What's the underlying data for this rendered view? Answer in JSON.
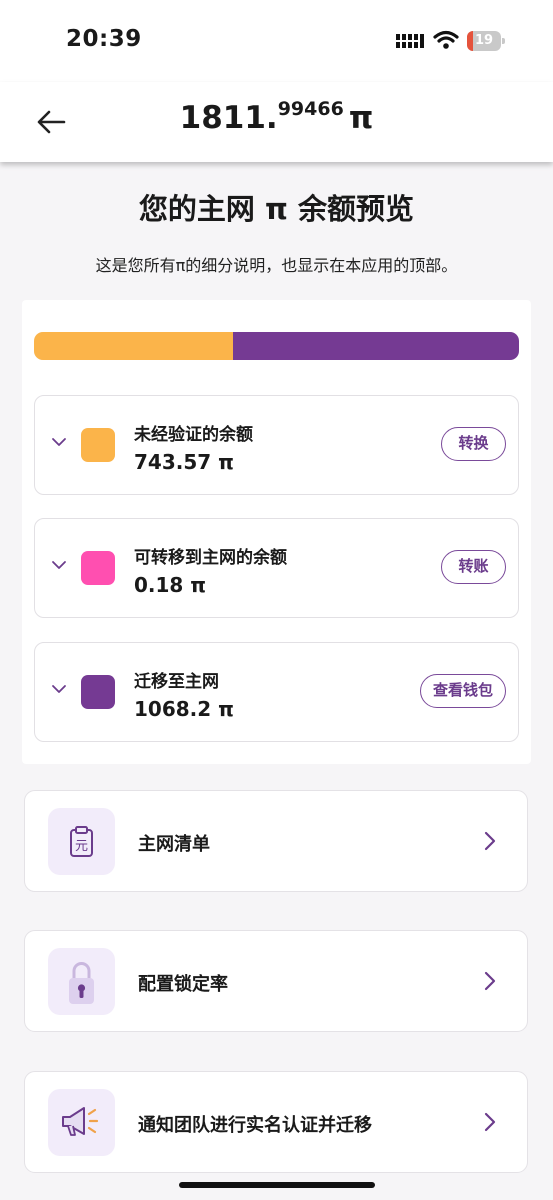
{
  "status_bar": {
    "time": "20:39",
    "battery": "19",
    "battery_level": 0.19
  },
  "header": {
    "balance_int": "1811.",
    "balance_dec": "99466",
    "balance_unit": "π"
  },
  "page": {
    "title": "您的主网 π 余额预览",
    "subtitle": "这是您所有π的细分说明，也显示在本应用的顶部。"
  },
  "distribution": {
    "segments": [
      {
        "name": "未经验证的余额",
        "value": 743.57,
        "color": "#fbb44a"
      },
      {
        "name": "可转移到主网的余额",
        "value": 0.18,
        "color": "#ff4fb0"
      },
      {
        "name": "迁移至主网",
        "value": 1068.2,
        "color": "#753a93"
      }
    ]
  },
  "items": [
    {
      "label": "未经验证的余额",
      "amount": "743.57 π",
      "button": "转换",
      "color": "#fbb44a"
    },
    {
      "label": "可转移到主网的余额",
      "amount": "0.18 π",
      "button": "转账",
      "color": "#ff4fb0"
    },
    {
      "label": "迁移至主网",
      "amount": "1068.2 π",
      "button": "查看钱包",
      "color": "#753a93"
    }
  ],
  "menu": [
    {
      "label": "主网清单",
      "icon": "clipboard-yuan-icon"
    },
    {
      "label": "配置锁定率",
      "icon": "padlock-icon"
    },
    {
      "label": "通知团队进行实名认证并迁移",
      "icon": "megaphone-icon"
    }
  ],
  "colors": {
    "accent": "#753a93",
    "background": "#f6f5f7"
  }
}
